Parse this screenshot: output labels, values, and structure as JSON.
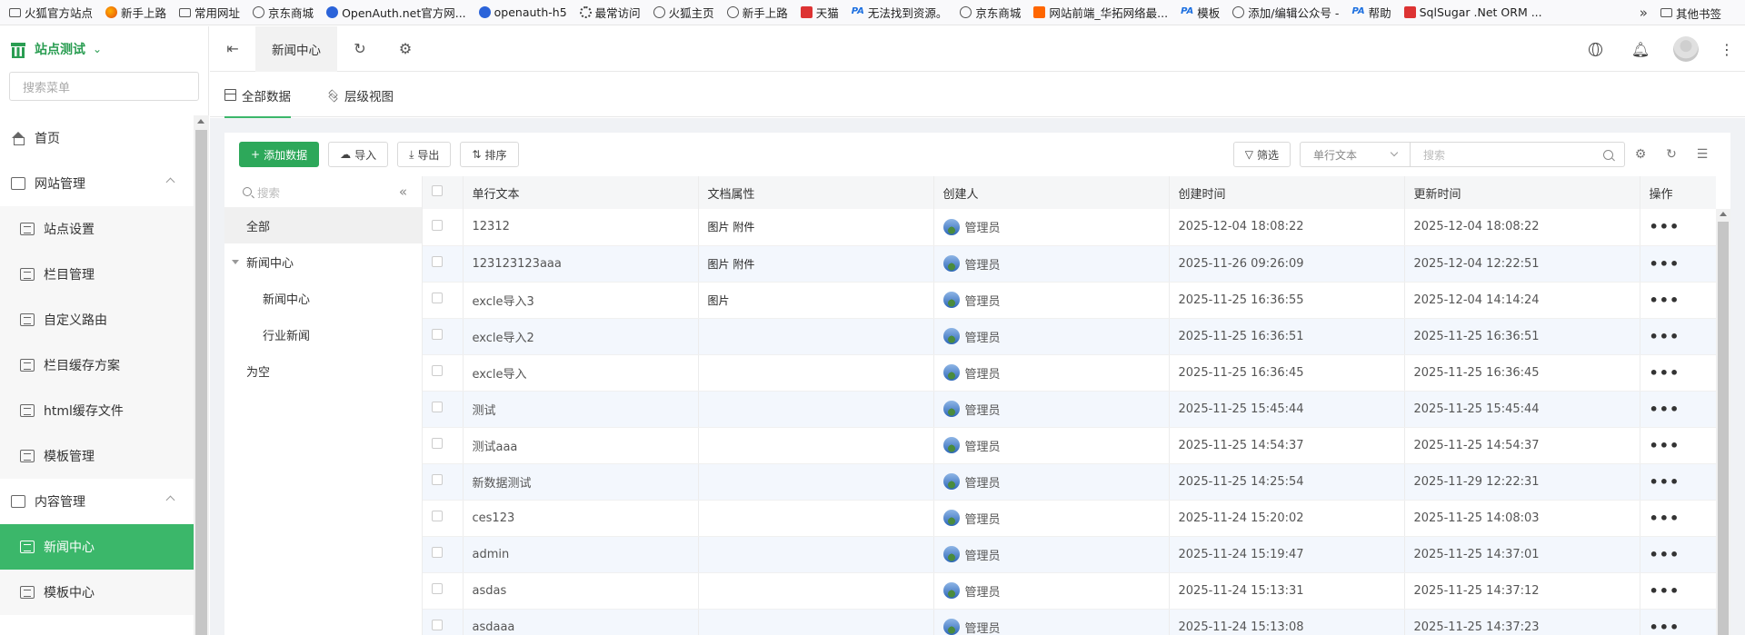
{
  "bookmarks": [
    {
      "icon": "folder-icon",
      "label": "火狐官方站点"
    },
    {
      "icon": "firefox-icon",
      "label": "新手上路"
    },
    {
      "icon": "folder-icon",
      "label": "常用网址"
    },
    {
      "icon": "globe-icon",
      "label": "京东商城"
    },
    {
      "icon": "openauth-icon",
      "label": "OpenAuth.net官方网..."
    },
    {
      "icon": "openauth-icon",
      "label": "openauth-h5"
    },
    {
      "icon": "gear-icon",
      "label": "最常访问"
    },
    {
      "icon": "globe-icon",
      "label": "火狐主页"
    },
    {
      "icon": "globe-icon",
      "label": "新手上路"
    },
    {
      "icon": "tmall-icon",
      "label": "天猫"
    },
    {
      "icon": "pa-icon",
      "label": "无法找到资源。"
    },
    {
      "icon": "globe-icon",
      "label": "京东商城"
    },
    {
      "icon": "58-icon",
      "label": "网站前端_华拓网络最..."
    },
    {
      "icon": "pa-icon",
      "label": "模板"
    },
    {
      "icon": "globe-icon",
      "label": "添加/编辑公众号 -"
    },
    {
      "icon": "pa-icon",
      "label": "帮助"
    },
    {
      "icon": "sqlsugar-icon",
      "label": "SqlSugar .Net ORM ..."
    }
  ],
  "bookmarks_other": "其他书签",
  "sidebar": {
    "site_name": "站点测试",
    "search_placeholder": "搜索菜单",
    "items": [
      {
        "label": "首页",
        "level": 1,
        "type": "home"
      },
      {
        "label": "网站管理",
        "level": 1,
        "type": "folder",
        "expanded": true
      },
      {
        "label": "站点设置",
        "level": 2
      },
      {
        "label": "栏目管理",
        "level": 2
      },
      {
        "label": "自定义路由",
        "level": 2
      },
      {
        "label": "栏目缓存方案",
        "level": 2
      },
      {
        "label": "html缓存文件",
        "level": 2
      },
      {
        "label": "模板管理",
        "level": 2
      },
      {
        "label": "内容管理",
        "level": 1,
        "type": "folder",
        "expanded": true
      },
      {
        "label": "新闻中心",
        "level": 2,
        "active": true
      },
      {
        "label": "模板中心",
        "level": 2
      }
    ]
  },
  "header": {
    "active_tab": "新闻中心"
  },
  "view_tabs": [
    "全部数据",
    "层级视图"
  ],
  "toolbar": {
    "add": "添加数据",
    "import": "导入",
    "export": "导出",
    "sort": "排序",
    "filter": "筛选",
    "field_select": "单行文本",
    "search_placeholder": "搜索"
  },
  "tree": {
    "search_placeholder": "搜索",
    "nodes": [
      {
        "label": "全部",
        "level": 0,
        "selected": true
      },
      {
        "label": "新闻中心",
        "level": 0,
        "expandable": true
      },
      {
        "label": "新闻中心",
        "level": 1
      },
      {
        "label": "行业新闻",
        "level": 1
      },
      {
        "label": "为空",
        "level": 0
      }
    ]
  },
  "table": {
    "columns": [
      "单行文本",
      "文档属性",
      "创建人",
      "创建时间",
      "更新时间",
      "操作"
    ],
    "rows": [
      {
        "text": "12312",
        "attr": "图片 附件",
        "creator": "管理员",
        "created": "2025-12-04 18:08:22",
        "updated": "2025-12-04 18:08:22"
      },
      {
        "text": "123123123aaa",
        "attr": "图片 附件",
        "creator": "管理员",
        "created": "2025-11-26 09:26:09",
        "updated": "2025-12-04 12:22:51"
      },
      {
        "text": "excle导入3",
        "attr": "图片",
        "creator": "管理员",
        "created": "2025-11-25 16:36:55",
        "updated": "2025-12-04 14:14:24"
      },
      {
        "text": "excle导入2",
        "attr": "",
        "creator": "管理员",
        "created": "2025-11-25 16:36:51",
        "updated": "2025-11-25 16:36:51"
      },
      {
        "text": "excle导入",
        "attr": "",
        "creator": "管理员",
        "created": "2025-11-25 16:36:45",
        "updated": "2025-11-25 16:36:45"
      },
      {
        "text": "测试",
        "attr": "",
        "creator": "管理员",
        "created": "2025-11-25 15:45:44",
        "updated": "2025-11-25 15:45:44"
      },
      {
        "text": "测试aaa",
        "attr": "",
        "creator": "管理员",
        "created": "2025-11-25 14:54:37",
        "updated": "2025-11-25 14:54:37"
      },
      {
        "text": "新数据测试",
        "attr": "",
        "creator": "管理员",
        "created": "2025-11-25 14:25:54",
        "updated": "2025-11-29 12:22:31"
      },
      {
        "text": "ces123",
        "attr": "",
        "creator": "管理员",
        "created": "2025-11-24 15:20:02",
        "updated": "2025-11-25 14:08:03"
      },
      {
        "text": "admin",
        "attr": "",
        "creator": "管理员",
        "created": "2025-11-24 15:19:47",
        "updated": "2025-11-25 14:37:01"
      },
      {
        "text": "asdas",
        "attr": "",
        "creator": "管理员",
        "created": "2025-11-24 15:13:31",
        "updated": "2025-11-25 14:37:12"
      },
      {
        "text": "asdaaa",
        "attr": "",
        "creator": "管理员",
        "created": "2025-11-24 15:13:08",
        "updated": "2025-11-25 14:37:23"
      }
    ],
    "more_glyph": "•••"
  },
  "colors": {
    "accent": "#3bb76a",
    "primary_button": "#2da85a",
    "row_alt": "#f3f7fd"
  }
}
